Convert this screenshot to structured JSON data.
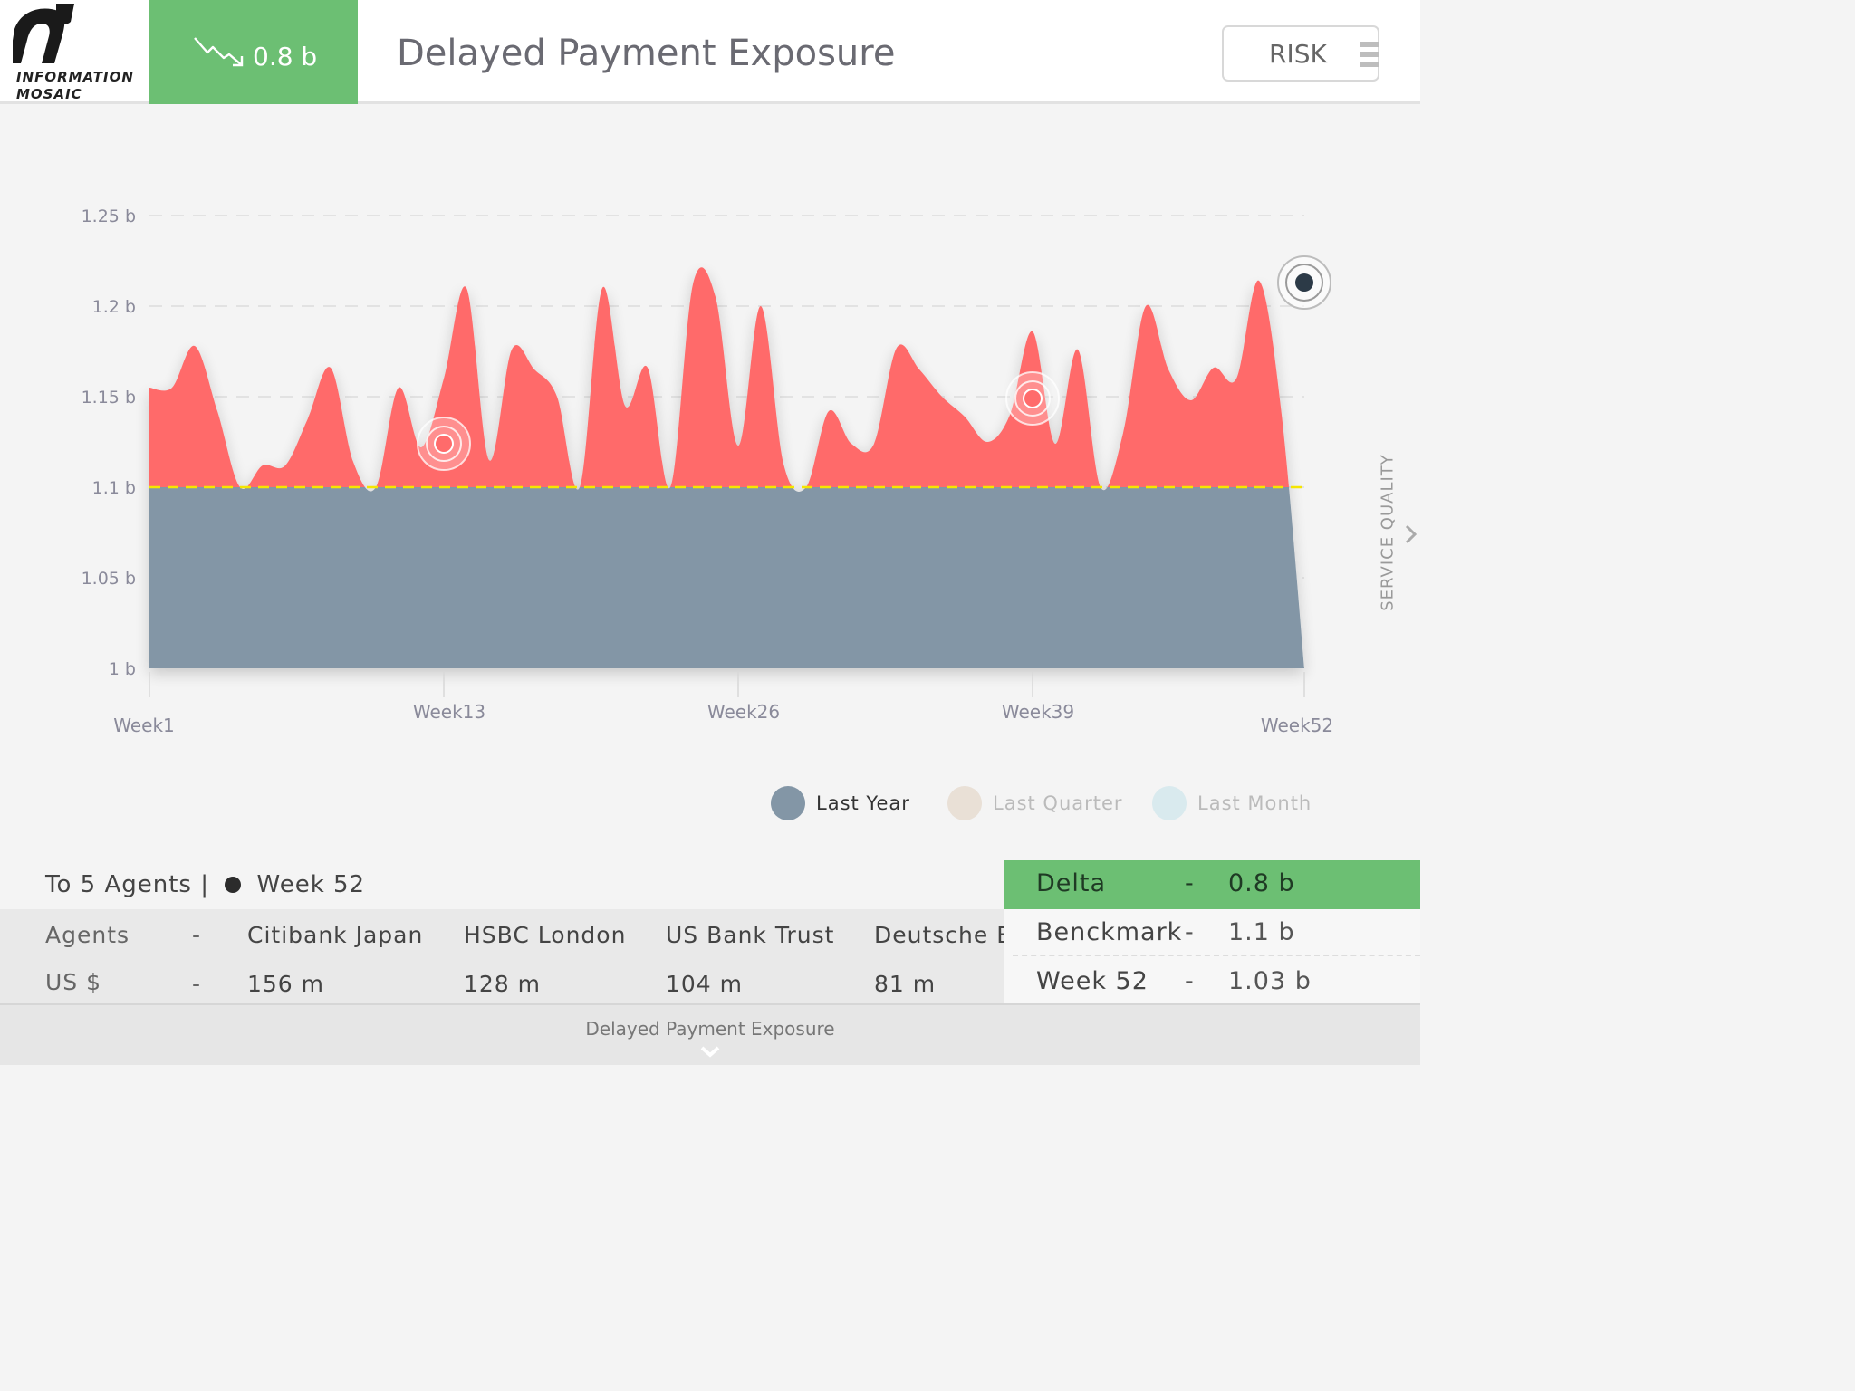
{
  "header": {
    "logo_line1": "INFORMATION",
    "logo_line2": "MOSAIC",
    "kpi_value": "0.8 b",
    "kpi_trend_icon": "trending-down-icon",
    "title": "Delayed Payment Exposure",
    "risk_label": "RISK",
    "menu_icon": "hamburger-menu-icon"
  },
  "side_panel": {
    "label": "SERVICE QUALITY",
    "icon": "chevron-right-icon"
  },
  "chart_data": {
    "type": "area",
    "title": "Delayed Payment Exposure",
    "xlabel": "",
    "ylabel": "",
    "y_ticks": [
      "1 b",
      "1.05 b",
      "1.1 b",
      "1.15 b",
      "1.2 b",
      "1.25 b"
    ],
    "ylim": [
      1.0,
      1.25
    ],
    "x_ticks": [
      "Week1",
      "Week13",
      "Week26",
      "Week39",
      "Week52"
    ],
    "benchmark": 1.1,
    "benchmark_color": "#f5e600",
    "grid": "horizontal dashed",
    "legend_placement": "bottom-right",
    "series": [
      {
        "name": "Last Year",
        "color": "#8396a6",
        "x": [
          1,
          2,
          3,
          4,
          5,
          6,
          7,
          8,
          9,
          10,
          11,
          12,
          13,
          14,
          15,
          16,
          17,
          18,
          19,
          20,
          21,
          22,
          23,
          24,
          25,
          26,
          27,
          28,
          29,
          30,
          31,
          32,
          33,
          34,
          35,
          36,
          37,
          38,
          39,
          40,
          41,
          42,
          43,
          44,
          45,
          46,
          47,
          48,
          49,
          50,
          51,
          52
        ],
        "values": [
          1.155,
          1.155,
          1.178,
          1.142,
          1.1,
          1.112,
          1.112,
          1.138,
          1.166,
          1.114,
          1.1,
          1.155,
          1.122,
          1.16,
          1.21,
          1.115,
          1.176,
          1.165,
          1.15,
          1.1,
          1.21,
          1.145,
          1.166,
          1.1,
          1.212,
          1.205,
          1.123,
          1.2,
          1.113,
          1.1,
          1.142,
          1.124,
          1.124,
          1.177,
          1.165,
          1.15,
          1.139,
          1.125,
          1.14,
          1.186,
          1.124,
          1.176,
          1.1,
          1.13,
          1.2,
          1.165,
          1.148,
          1.166,
          1.16,
          1.214,
          1.14,
          1.0
        ]
      }
    ],
    "markers": [
      {
        "label": "Week13",
        "x": 14,
        "y": 1.124,
        "color": "#ff6b6b"
      },
      {
        "label": "Week39",
        "x": 40,
        "y": 1.149,
        "color": "#ff6b6b"
      },
      {
        "label": "Week52",
        "x": 52,
        "y": 1.213,
        "color": "#2c3a47"
      }
    ],
    "above_benchmark_color": "#ff6b6b"
  },
  "legend": [
    {
      "label": "Last Year",
      "color": "#8396a6",
      "label_color": "#333333"
    },
    {
      "label": "Last Quarter",
      "color": "#e9e0d6",
      "label_color": "#bbbbbb"
    },
    {
      "label": "Last Month",
      "color": "#d9eaee",
      "label_color": "#bbbbbb"
    }
  ],
  "agents_table": {
    "heading_prefix": "To 5 Agents |",
    "heading_week": "Week 52",
    "rows": [
      {
        "label": "Agents",
        "dash": "-",
        "cells": [
          "Citibank Japan",
          "HSBC London",
          "US Bank Trust",
          "Deutsche Ba"
        ]
      },
      {
        "label": "US $",
        "dash": "-",
        "cells": [
          "156 m",
          "128 m",
          "104 m",
          "81 m"
        ]
      }
    ]
  },
  "summary": [
    {
      "label": "Delta",
      "dash": "-",
      "value": "0.8 b",
      "active": true
    },
    {
      "label": "Benckmark",
      "dash": "-",
      "value": "1.1 b",
      "active": false
    },
    {
      "label": "Week 52",
      "dash": "-",
      "value": "1.03 b",
      "active": false
    }
  ],
  "footer": {
    "label": "Delayed Payment Exposure",
    "icon": "chevron-down-icon"
  }
}
